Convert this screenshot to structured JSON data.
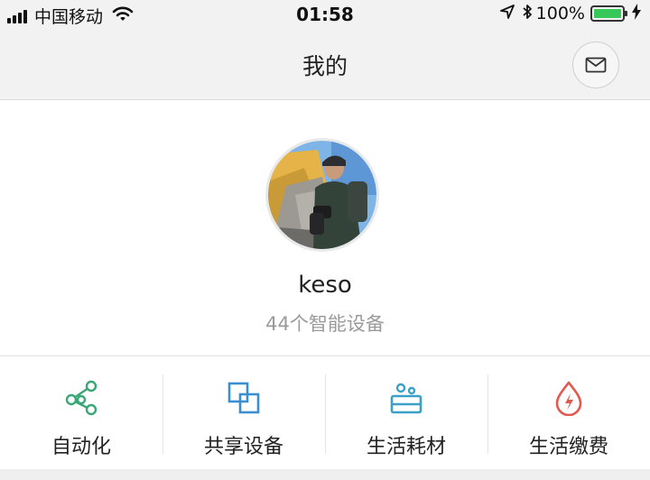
{
  "status_bar": {
    "carrier": "中国移动",
    "time": "01:58",
    "battery_percent": "100%",
    "battery_level": 1.0,
    "icons": [
      "signal-icon",
      "wifi-icon",
      "location-arrow-icon",
      "bluetooth-icon",
      "battery-icon",
      "charging-icon"
    ]
  },
  "nav": {
    "title": "我的",
    "mail_icon": "mail-icon"
  },
  "profile": {
    "username": "keso",
    "device_count": "44个智能设备"
  },
  "actions": [
    {
      "label": "自动化",
      "icon": "automation-nodes-icon",
      "color": "#3aa876"
    },
    {
      "label": "共享设备",
      "icon": "shared-devices-icon",
      "color": "#3b8fd0"
    },
    {
      "label": "生活耗材",
      "icon": "consumables-icon",
      "color": "#3aa0c8"
    },
    {
      "label": "生活缴费",
      "icon": "bill-payment-icon",
      "color": "#e05a4f"
    }
  ]
}
